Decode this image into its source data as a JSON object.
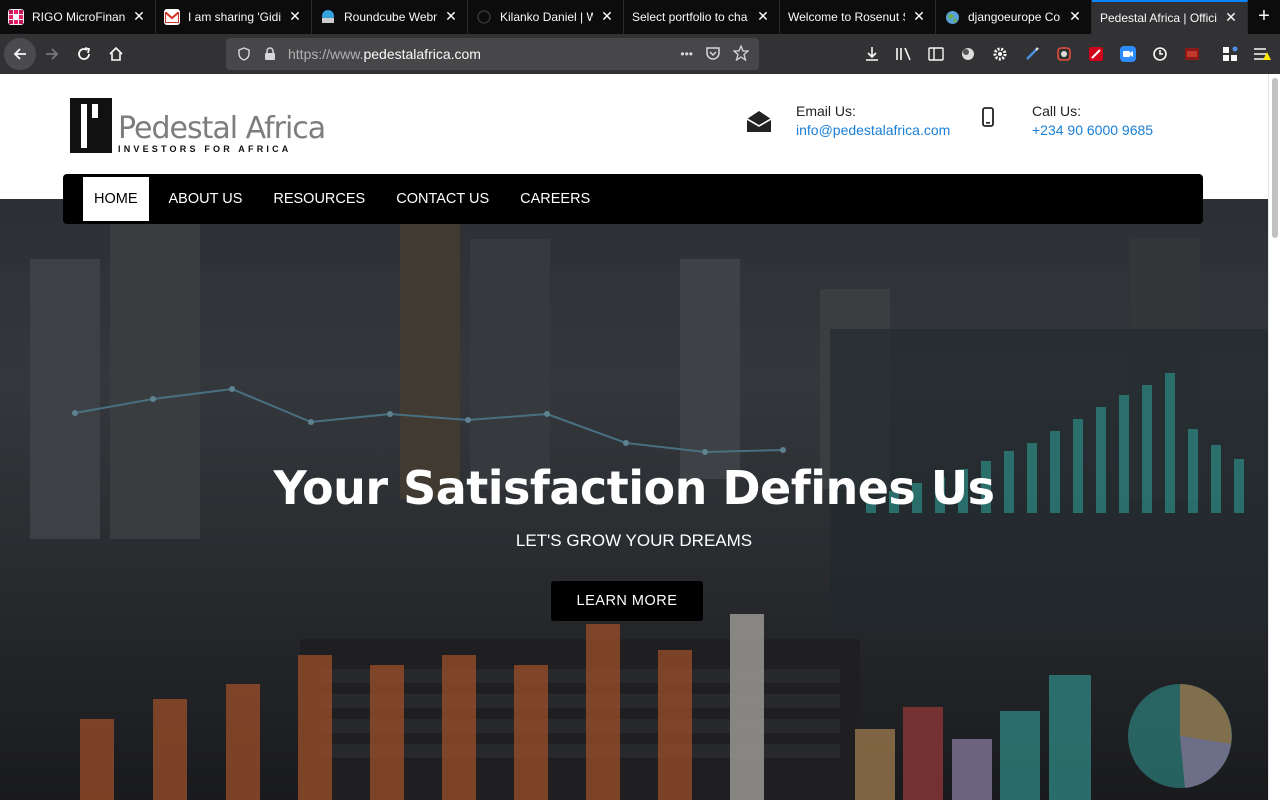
{
  "browser": {
    "tabs": [
      {
        "title": "RIGO MicroFinance",
        "favicon": "rigo-favicon",
        "active": false
      },
      {
        "title": "I am sharing 'Gidi",
        "favicon": "gmail-icon",
        "active": false
      },
      {
        "title": "Roundcube Webmail",
        "favicon": "roundcube-icon",
        "active": false
      },
      {
        "title": "Kilanko Daniel | W",
        "favicon": "github-icon",
        "active": false
      },
      {
        "title": "Select portfolio to cha",
        "favicon": "",
        "active": false
      },
      {
        "title": "Welcome to Rosenut S",
        "favicon": "",
        "active": false
      },
      {
        "title": "djangoeurope Con",
        "favicon": "globe-icon",
        "active": false
      },
      {
        "title": "Pedestal Africa | Offici",
        "favicon": "",
        "active": true
      }
    ],
    "url_prefix": "https://www.",
    "url_domain": "pedestalafrica.com",
    "url_menu": "•••"
  },
  "site": {
    "logo_name": "Pedestal Africa",
    "logo_tagline": "INVESTORS FOR AFRICA",
    "email_label": "Email Us:",
    "email_value": "info@pedestalafrica.com",
    "phone_label": "Call Us:",
    "phone_value": "+234 90 6000 9685",
    "nav": [
      "HOME",
      "ABOUT US",
      "RESOURCES",
      "CONTACT US",
      "CAREERS"
    ],
    "hero_title": "Your Satisfaction Defines Us",
    "hero_subtitle": "LET'S GROW YOUR DREAMS",
    "hero_button": "LEARN MORE"
  },
  "colors": {
    "accent": "#0a84ff",
    "link": "#1a7fd6",
    "nav_bg": "#000000",
    "hero_chart_teal": "#3fb8b0",
    "hero_chart_orange": "#e0713a"
  }
}
